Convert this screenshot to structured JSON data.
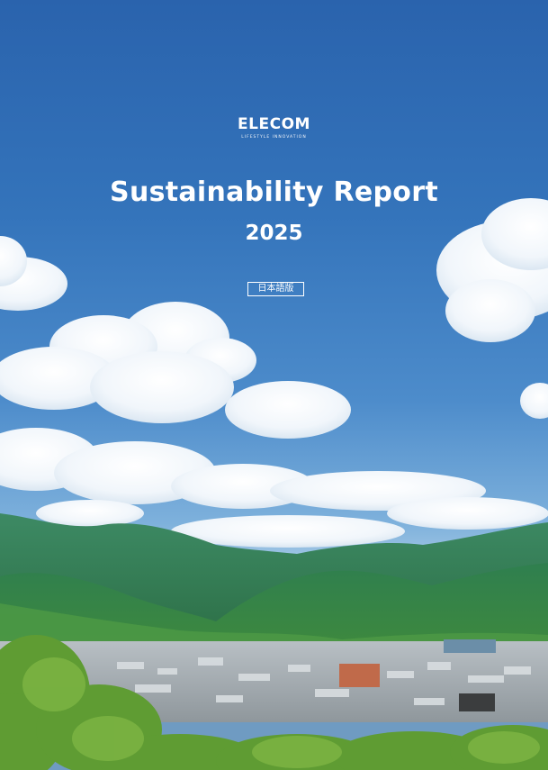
{
  "brand": {
    "name": "ELECOM",
    "tagline": "LIFESTYLE INNOVATION"
  },
  "report": {
    "title": "Sustainability Report",
    "year": "2025",
    "edition": "日本語版"
  },
  "colors": {
    "sky_top": "#2a63ad",
    "sky_mid": "#4d8ccb",
    "mountain": "#2f7a4a",
    "foliage": "#5a9a35",
    "text": "#ffffff"
  }
}
